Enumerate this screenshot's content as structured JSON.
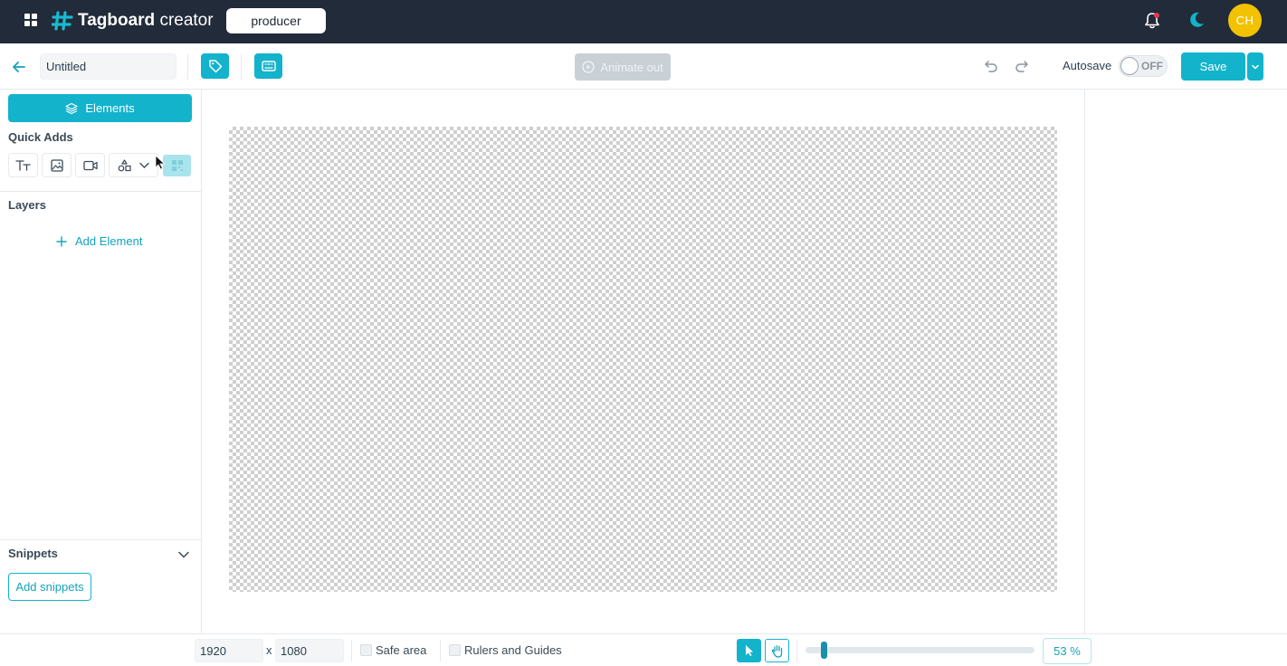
{
  "topbar": {
    "brand_bold": "Tagboard",
    "brand_light": "creator",
    "role": "producer",
    "avatar_initials": "CH",
    "notification_dot_color": "#e8345a",
    "accent_color": "#13b3cc"
  },
  "toolbar": {
    "title_value": "Untitled",
    "animate_out_label": "Animate out",
    "autosave_label": "Autosave",
    "autosave_state": "OFF",
    "save_label": "Save"
  },
  "left_panel": {
    "elements_label": "Elements",
    "quick_adds_title": "Quick Adds",
    "quick_adds_items": [
      "text-icon",
      "image-icon",
      "video-icon",
      "shapes-icon",
      "qr-code-icon"
    ],
    "layers_title": "Layers",
    "add_element_label": "Add Element",
    "snippets_title": "Snippets",
    "add_snippets_label": "Add snippets"
  },
  "bottombar": {
    "width_value": "1920",
    "x_label": "x",
    "height_value": "1080",
    "safe_area_label": "Safe area",
    "rulers_label": "Rulers and Guides",
    "zoom_level": "53 %",
    "zoom_fraction": 0.07
  }
}
